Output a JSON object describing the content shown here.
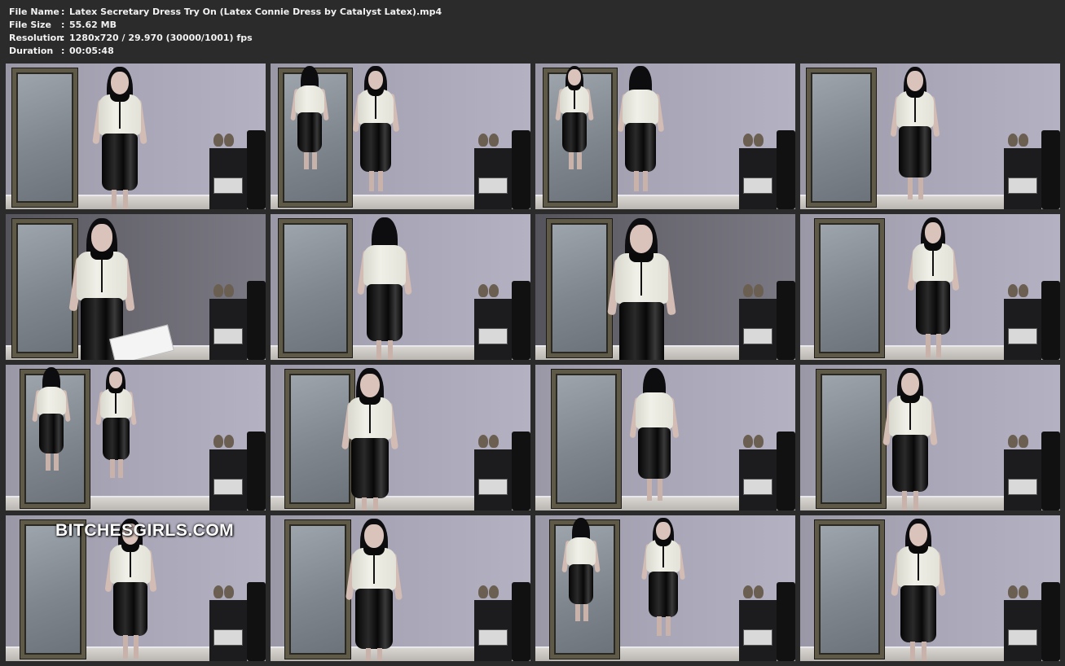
{
  "info": {
    "file_name_label": "File Name",
    "file_name": "Latex Secretary Dress Try On (Latex Connie Dress by Catalyst Latex).mp4",
    "file_size_label": "File Size",
    "file_size": "55.62 MB",
    "resolution_label": "Resolution",
    "resolution": "1280x720 / 29.970 (30000/1001) fps",
    "duration_label": "Duration",
    "duration": "00:05:48",
    "separator": ":"
  },
  "grid": {
    "rows": 4,
    "columns": 4,
    "frame_count": 16
  },
  "watermark": "BITCHESGIRLS.COM",
  "colors": {
    "background": "#2b2b2b",
    "header_text": "#f2f2f2",
    "wall": "#a8a6b6",
    "latex_black": "#0a0a0a",
    "latex_cream": "#ecece2"
  }
}
